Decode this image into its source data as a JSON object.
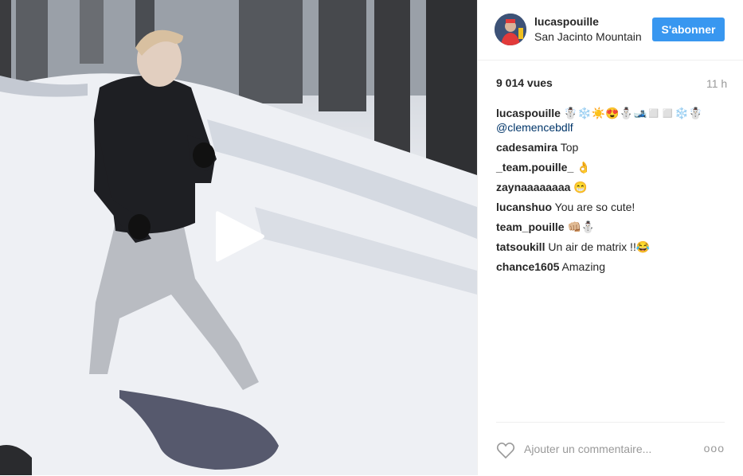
{
  "post": {
    "username": "lucaspouille",
    "location": "San Jacinto Mountain",
    "follow_label": "S'abonner",
    "views": "9 014 vues",
    "time": "11 h"
  },
  "caption": {
    "user": "lucaspouille",
    "text": "☃️❄️☀️😍⛄🎿◻️◻️❄️☃️",
    "mention": "@clemencebdlf"
  },
  "comments": [
    {
      "user": "cadesamira",
      "text": "Top"
    },
    {
      "user": "_team.pouille_",
      "text": "👌"
    },
    {
      "user": "zaynaaaaaaaa",
      "text": "😁"
    },
    {
      "user": "lucanshuo",
      "text": "You are so cute!"
    },
    {
      "user": "team_pouille",
      "text": "👊🏼⛄"
    },
    {
      "user": "tatsoukill",
      "text": "Un air de matrix !!😂"
    },
    {
      "user": "chance1605",
      "text": "Amazing"
    }
  ],
  "footer": {
    "add_comment_placeholder": "Ajouter un commentaire...",
    "more_label": "ooo"
  },
  "colors": {
    "follow_button": "#3897f0",
    "mention": "#003569",
    "muted": "#999999"
  },
  "icons": {
    "play": "play-icon",
    "heart": "heart-icon",
    "more": "more-options-icon"
  }
}
